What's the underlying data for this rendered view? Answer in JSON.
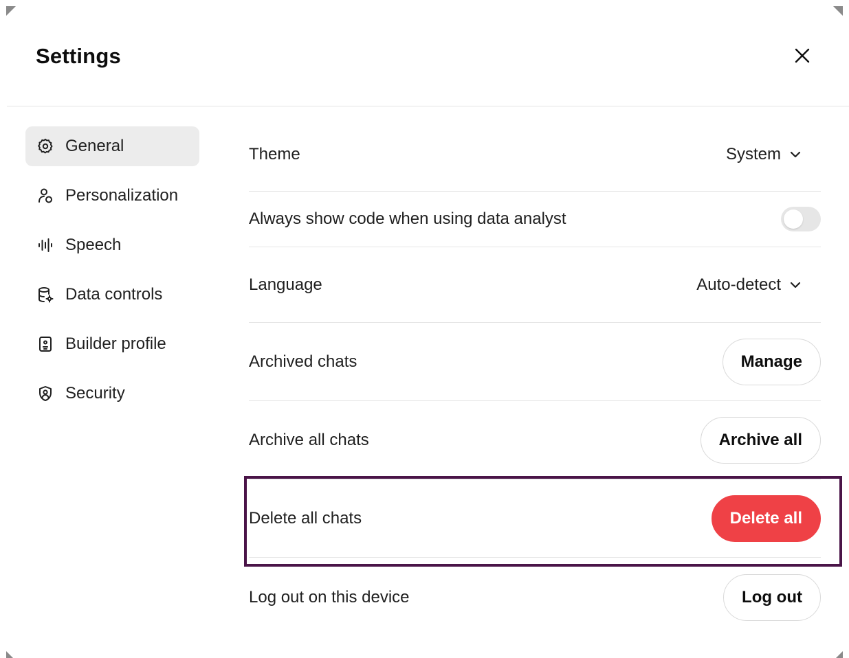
{
  "dialog": {
    "title": "Settings",
    "close_icon": "close-icon"
  },
  "sidebar": {
    "items": [
      {
        "label": "General",
        "icon": "gear-icon",
        "active": true
      },
      {
        "label": "Personalization",
        "icon": "person-icon",
        "active": false
      },
      {
        "label": "Speech",
        "icon": "waveform-icon",
        "active": false
      },
      {
        "label": "Data controls",
        "icon": "database-gear-icon",
        "active": false
      },
      {
        "label": "Builder profile",
        "icon": "id-card-icon",
        "active": false
      },
      {
        "label": "Security",
        "icon": "shield-user-icon",
        "active": false
      }
    ]
  },
  "settings": {
    "theme": {
      "label": "Theme",
      "value": "System"
    },
    "show_code": {
      "label": "Always show code when using data analyst",
      "enabled": false
    },
    "language": {
      "label": "Language",
      "value": "Auto-detect"
    },
    "archived_chats": {
      "label": "Archived chats",
      "button": "Manage"
    },
    "archive_all": {
      "label": "Archive all chats",
      "button": "Archive all"
    },
    "delete_all": {
      "label": "Delete all chats",
      "button": "Delete all"
    },
    "logout": {
      "label": "Log out on this device",
      "button": "Log out"
    }
  },
  "colors": {
    "danger": "#ef4146",
    "highlight_border": "#4a1448",
    "active_nav_bg": "#ececec",
    "toggle_off": "#e6e6e6"
  }
}
